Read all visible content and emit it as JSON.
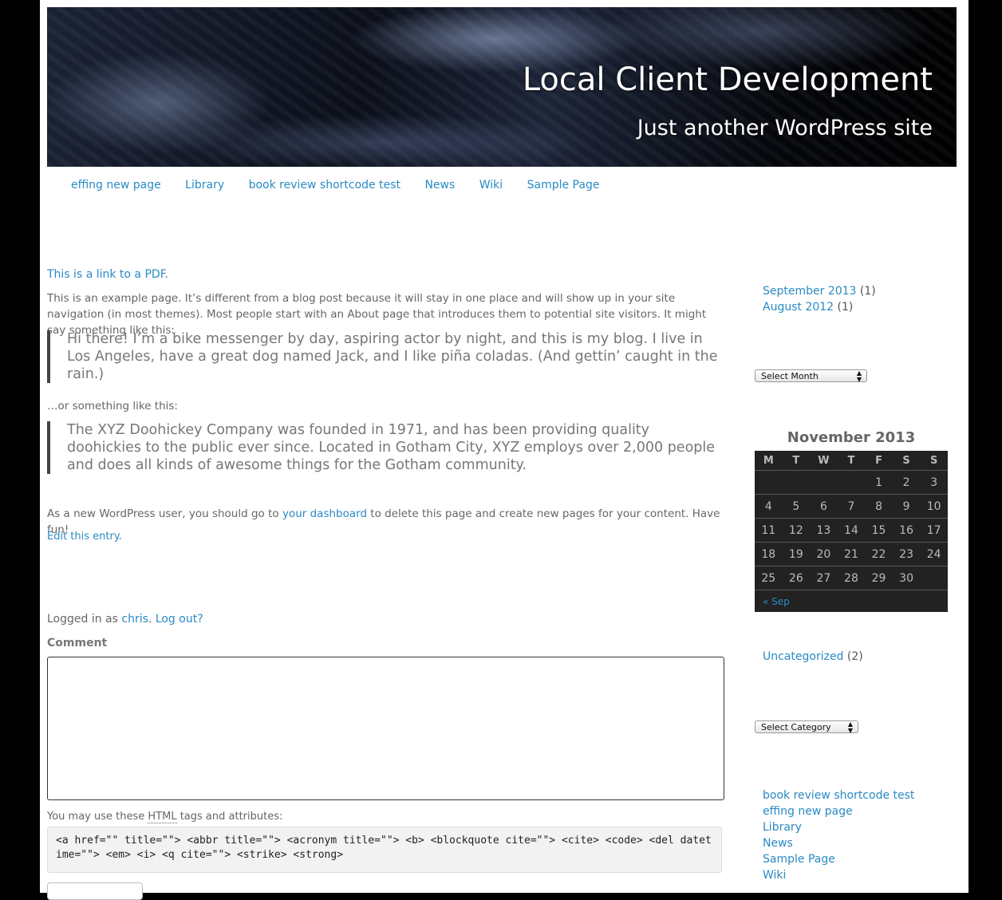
{
  "site": {
    "title": "Local Client Development",
    "description": "Just another WordPress site"
  },
  "nav": {
    "items": [
      "effing new page",
      "Library",
      "book review shortcode test",
      "News",
      "Wiki",
      "Sample Page"
    ]
  },
  "content": {
    "pdf_link": "This is a link to a PDF.",
    "intro": "This is an example page. It’s different from a blog post because it will stay in one place and will show up in your site navigation (in most themes). Most people start with an About page that introduces them to potential site visitors. It might say something like this:",
    "quote1": "Hi there! I’m a bike messenger by day, aspiring actor by night, and this is my blog. I live in Los Angeles, have a great dog named Jack, and I like piña coladas. (And gettin’ caught in the rain.)",
    "or_text": "…or something like this:",
    "quote2": "The XYZ Doohickey Company was founded in 1971, and has been providing quality doohickies to the public ever since. Located in Gotham City, XYZ employs over 2,000 people and does all kinds of awesome things for the Gotham community.",
    "dashboard_before": "As a new WordPress user, you should go to ",
    "dashboard_link": "your dashboard",
    "dashboard_after": " to delete this page and create new pages for your content. Have fun!",
    "edit_link": "Edit this entry."
  },
  "comment": {
    "logged_prefix": "Logged in as ",
    "user": "chris",
    "dot": ".",
    "logout": "Log out?",
    "label": "Comment",
    "allowed_prefix": "You may use these ",
    "allowed_abbr": "HTML",
    "allowed_suffix": " tags and attributes:",
    "tags": "<a href=\"\" title=\"\"> <abbr title=\"\"> <acronym title=\"\"> <b> <blockquote cite=\"\"> <cite> <code> <del datetime=\"\"> <em> <i> <q cite=\"\"> <strike> <strong>"
  },
  "sidebar": {
    "archives": [
      {
        "label": "September 2013",
        "count": "(1)"
      },
      {
        "label": "August 2012",
        "count": "(1)"
      }
    ],
    "month_select": "Select Month",
    "calendar": {
      "caption": "November 2013",
      "headers": [
        "M",
        "T",
        "W",
        "T",
        "F",
        "S",
        "S"
      ],
      "weeks": [
        [
          "",
          "",
          "",
          "",
          "1",
          "2",
          "3"
        ],
        [
          "4",
          "5",
          "6",
          "7",
          "8",
          "9",
          "10"
        ],
        [
          "11",
          "12",
          "13",
          "14",
          "15",
          "16",
          "17"
        ],
        [
          "18",
          "19",
          "20",
          "21",
          "22",
          "23",
          "24"
        ],
        [
          "25",
          "26",
          "27",
          "28",
          "29",
          "30",
          ""
        ]
      ],
      "prev": "« Sep"
    },
    "categories": [
      {
        "label": "Uncategorized",
        "count": "(2)"
      }
    ],
    "category_select": "Select Category",
    "pages": [
      "book review shortcode test",
      "effing new page",
      "Library",
      "News",
      "Sample Page",
      "Wiki"
    ]
  },
  "colors": {
    "link": "#2a8ac4",
    "calendar_bg": "#222222",
    "frame": "#000000"
  }
}
